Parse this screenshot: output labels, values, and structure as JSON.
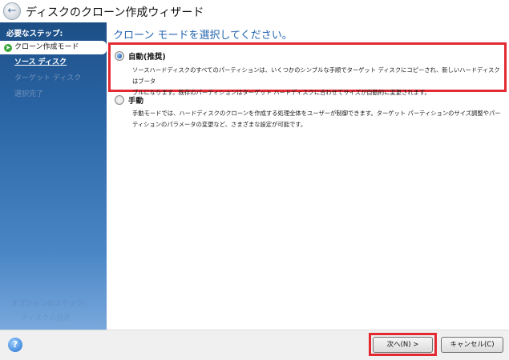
{
  "window": {
    "title": "ディスクのクローン作成ウィザード"
  },
  "sidebar": {
    "heading": "必要なステップ:",
    "steps": [
      {
        "label": "クローン作成モード",
        "state": "current"
      },
      {
        "label": "ソース ディスク",
        "state": "link"
      },
      {
        "label": "ターゲット ディスク",
        "state": "disabled"
      },
      {
        "label": "選択完了",
        "state": "disabled"
      }
    ],
    "optional_heading": "オプションのステップ:",
    "optional_item": "ディスクの除外"
  },
  "main": {
    "heading": "クローン モードを選択してください。",
    "options": [
      {
        "label": "自動(推奨)",
        "selected": true,
        "desc_lines": [
          "ソースハードディスクのすべてのパーティションは、いくつかのシンプルな手順でターゲット ディスクにコピーされ、新しいハードディスクはブータ",
          "ブルになります。既存のパーティションはターゲット ハードディスクに合わせてサイズが自動的に変更されます。"
        ]
      },
      {
        "label": "手動",
        "selected": false,
        "desc_lines": [
          "手動モードでは、ハードディスクのクローンを作成する処理全体をユーザーが制御できます。ターゲット パーティションのサイズ調整やパー",
          "ティションのパラメータの変更など、さまざまな設定が可能です。"
        ]
      }
    ]
  },
  "footer": {
    "next_label": "次へ(N) >",
    "cancel_label": "キャンセル(C)"
  },
  "colors": {
    "highlight": "#e32a33",
    "heading": "#2465b0"
  }
}
